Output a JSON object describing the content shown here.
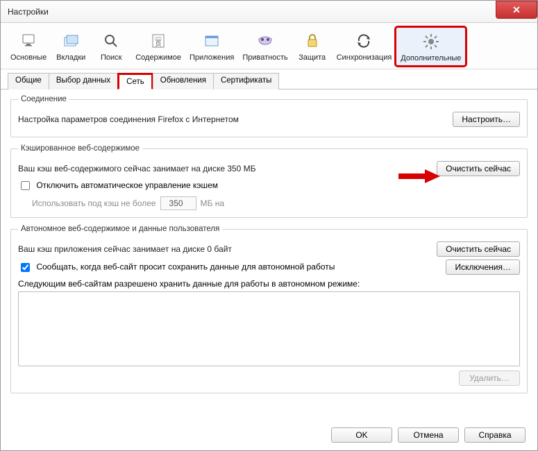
{
  "window": {
    "title": "Настройки",
    "close": "X"
  },
  "toolbar": {
    "items": [
      {
        "label": "Основные",
        "icon": "monitor"
      },
      {
        "label": "Вкладки",
        "icon": "tabs"
      },
      {
        "label": "Поиск",
        "icon": "search"
      },
      {
        "label": "Содержимое",
        "icon": "content"
      },
      {
        "label": "Приложения",
        "icon": "apps"
      },
      {
        "label": "Приватность",
        "icon": "mask"
      },
      {
        "label": "Защита",
        "icon": "lock"
      },
      {
        "label": "Синхронизация",
        "icon": "sync"
      },
      {
        "label": "Дополнительные",
        "icon": "gear"
      }
    ]
  },
  "tabs": {
    "items": [
      "Общие",
      "Выбор данных",
      "Сеть",
      "Обновления",
      "Сертификаты"
    ],
    "active": "Сеть"
  },
  "sections": {
    "connection": {
      "legend": "Соединение",
      "desc": "Настройка параметров соединения Firefox с Интернетом",
      "button": "Настроить…"
    },
    "cache": {
      "legend": "Кэшированное веб-содержимое",
      "desc": "Ваш кэш веб-содержимого сейчас занимает на диске 350 МБ",
      "button": "Очистить сейчас",
      "checkbox": "Отключить автоматическое управление кэшем",
      "limit_label_pre": "Использовать под кэш не более",
      "limit_value": "350",
      "limit_unit": "МБ на"
    },
    "offline": {
      "legend": "Автономное веб-содержимое и данные пользователя",
      "desc": "Ваш кэш приложения сейчас занимает на диске 0 байт",
      "clear_button": "Очистить сейчас",
      "notify_checkbox": "Сообщать, когда веб-сайт просит сохранить данные для автономной работы",
      "exceptions_button": "Исключения…",
      "sites_label": "Следующим веб-сайтам разрешено хранить данные для работы в автономном режиме:",
      "delete_button": "Удалить…"
    }
  },
  "footer": {
    "ok": "OK",
    "cancel": "Отмена",
    "help": "Справка"
  }
}
